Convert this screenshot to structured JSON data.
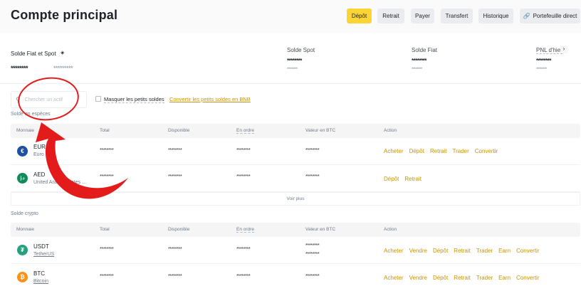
{
  "header": {
    "title": "Compte principal",
    "buttons": [
      "Dépôt",
      "Retrait",
      "Payer",
      "Transfert",
      "Historique",
      "Portefeuille direct"
    ]
  },
  "balance": {
    "label": "Solde Fiat et Spot",
    "value": "********",
    "value_secondary": "*********",
    "stats": [
      {
        "label": "Solde Spot",
        "value": "********",
        "sub": "********"
      },
      {
        "label": "Solde Fiat",
        "value": "********",
        "sub": "********"
      },
      {
        "label": "PNL d'hier",
        "value": "********",
        "sub": "********"
      }
    ]
  },
  "filters": {
    "search_placeholder": "Chercher un actif",
    "hide_small": "Masquer les petits soldes",
    "convert_small": "Convertir les petits soldes en BNB"
  },
  "columns": [
    "Monnaie",
    "Total",
    "Disponible",
    "En ordre",
    "Valeur en BTC",
    "Action"
  ],
  "fiat": {
    "title": "Solde en espèces",
    "more": "Voir plus",
    "rows": [
      {
        "code": "EUR",
        "name": "Euro",
        "total": "********",
        "available": "********",
        "in_order": "********",
        "btc": "********",
        "actions": [
          "Acheter",
          "Dépôt",
          "Retrait",
          "Trader",
          "Convertir"
        ],
        "color": "#1d4fa3",
        "icon": "€"
      },
      {
        "code": "AED",
        "name": "United Arab Emirates ...",
        "total": "********",
        "available": "********",
        "in_order": "********",
        "btc": "********",
        "actions": [
          "Dépôt",
          "Retrait"
        ],
        "color": "#138a5a",
        "icon": "د.إ"
      }
    ]
  },
  "crypto": {
    "title": "Solde crypto",
    "rows": [
      {
        "code": "USDT",
        "name": "TetherUS",
        "total": "********",
        "available": "********",
        "in_order": "********",
        "btc": "********",
        "btc_sub": "********",
        "actions": [
          "Acheter",
          "Vendre",
          "Dépôt",
          "Retrait",
          "Trader",
          "Earn",
          "Convertir"
        ],
        "color": "#26a17b",
        "icon": "₮"
      },
      {
        "code": "BTC",
        "name": "Bitcoin",
        "total": "********",
        "available": "********",
        "in_order": "********",
        "btc": "********",
        "actions": [
          "Acheter",
          "Vendre",
          "Dépôt",
          "Retrait",
          "Trader",
          "Earn",
          "Convertir"
        ],
        "color": "#f7931a",
        "icon": "₿"
      }
    ]
  },
  "colors": {
    "primary": "#fcd535",
    "action": "#c99400",
    "annotation": "#e31b1b"
  }
}
